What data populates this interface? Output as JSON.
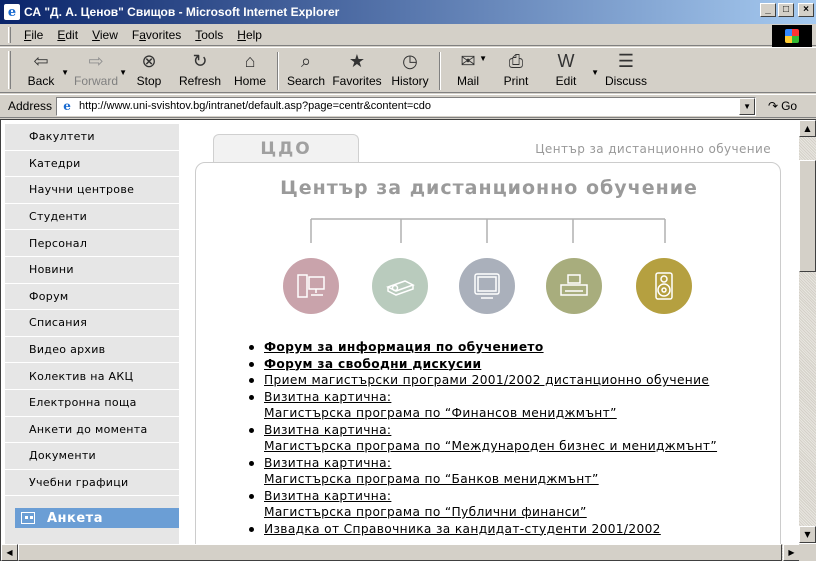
{
  "window": {
    "title": "СА \"Д. А. Ценов\" Свищов - Microsoft Internet Explorer",
    "minimize": "_",
    "maximize": "□",
    "close": "×"
  },
  "menu": [
    {
      "label": "File",
      "underline": "F"
    },
    {
      "label": "Edit",
      "underline": "E"
    },
    {
      "label": "View",
      "underline": "V"
    },
    {
      "label": "Favorites",
      "underline": "a"
    },
    {
      "label": "Tools",
      "underline": "T"
    },
    {
      "label": "Help",
      "underline": "H"
    }
  ],
  "toolbar": {
    "back": "Back",
    "forward": "Forward",
    "stop": "Stop",
    "refresh": "Refresh",
    "home": "Home",
    "search": "Search",
    "favorites": "Favorites",
    "history": "History",
    "mail": "Mail",
    "print": "Print",
    "edit": "Edit",
    "discuss": "Discuss"
  },
  "address": {
    "label": "Address",
    "url": "http://www.uni-svishtov.bg/intranet/default.asp?page=centr&content=cdo",
    "go": "Go"
  },
  "sidebar": {
    "items": [
      "Факултети",
      "Катедри",
      "Научни центрове",
      "Студенти",
      "Персонал",
      "Новини",
      "Форум",
      "Списания",
      "Видео архив",
      "Колектив на АКЦ",
      "Електронна поща",
      "Анкети до момента",
      "Документи",
      "Учебни графици"
    ],
    "poll_label": "Анкета"
  },
  "main": {
    "tab_label": "ЦДО",
    "header_right": "Център за дистанционно обучение",
    "title": "Център за дистанционно обучение",
    "icons": [
      {
        "name": "computer-icon",
        "color": "#c9a3ab"
      },
      {
        "name": "projector-icon",
        "color": "#b9cbbd"
      },
      {
        "name": "monitor-icon",
        "color": "#aab0bb"
      },
      {
        "name": "printer-icon",
        "color": "#a8ad7d"
      },
      {
        "name": "speaker-icon",
        "color": "#b5a040"
      }
    ],
    "links": [
      {
        "text": "Форум за информация по обучението",
        "bold": true
      },
      {
        "text": "Форум за свободни дискусии",
        "bold": true
      },
      {
        "text": "Прием магистърски програми 2001/2002 дистанционно обучение",
        "bold": false
      },
      {
        "text": "Визитна картична:",
        "line2": "Магистърска програма по “Финансов мениджмънт”"
      },
      {
        "text": "Визитна картична:",
        "line2": "Магистърска програма по “Международен бизнес и мениджмънт”"
      },
      {
        "text": "Визитна картична:",
        "line2": "Магистърска програма по “Банков мениджмънт”"
      },
      {
        "text": "Визитна картична:",
        "line2": "Магистърска програма по “Публични финанси”"
      },
      {
        "text": "Извадка от Справочника за кандидат-студенти 2001/2002",
        "bold": false
      }
    ]
  }
}
